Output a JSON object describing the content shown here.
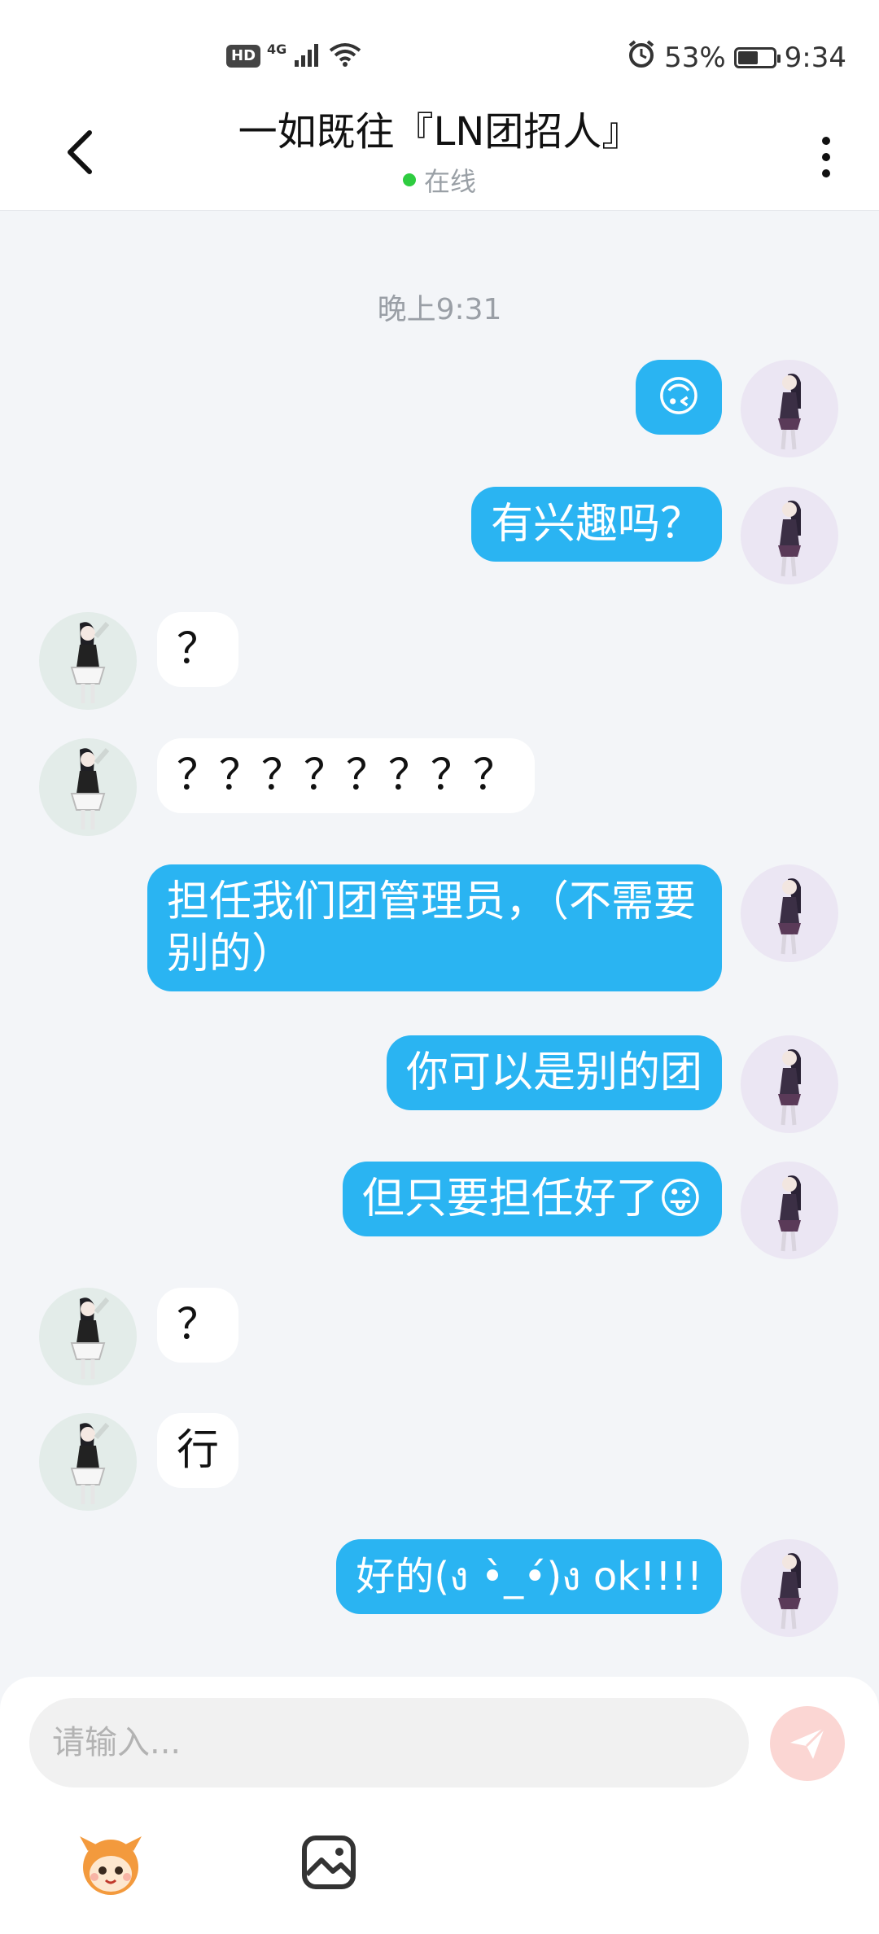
{
  "status_bar": {
    "hd": "HD",
    "network": "4G",
    "battery_percent": "53%",
    "battery_level": 0.53,
    "time": "9:34"
  },
  "header": {
    "title": "一如既往『LN团招人』",
    "status": "在线",
    "status_color": "#2ecc40"
  },
  "chat": {
    "timestamp": "晚上9:31",
    "messages": [
      {
        "from": "me",
        "text": "🙃"
      },
      {
        "from": "me",
        "text": "有兴趣吗？"
      },
      {
        "from": "them",
        "text": "？"
      },
      {
        "from": "them",
        "text": "？？？？？？？？"
      },
      {
        "from": "me",
        "text": "担任我们团管理员，（不需要别的）"
      },
      {
        "from": "me",
        "text": "你可以是别的团"
      },
      {
        "from": "me",
        "text": "但只要担任好了😜"
      },
      {
        "from": "them",
        "text": "？"
      },
      {
        "from": "them",
        "text": "行"
      },
      {
        "from": "me",
        "text": "好的(ง •̀_•́)ง ok!!!!"
      }
    ]
  },
  "input": {
    "placeholder": "请输入...",
    "send_icon": "paper-plane-icon",
    "tools": [
      "emoji-mascot-icon",
      "image-icon"
    ]
  },
  "colors": {
    "my_bubble": "#2ab4f2",
    "their_bubble": "#ffffff",
    "background": "#f3f5f8",
    "send_button": "#fbd6d3"
  }
}
